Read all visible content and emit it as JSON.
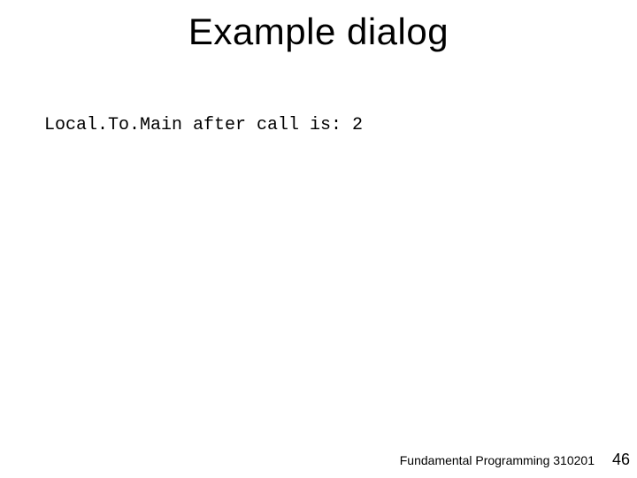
{
  "slide": {
    "title": "Example dialog",
    "body_line": "Local.To.Main after call is: 2",
    "footer": "Fundamental Programming 310201",
    "page_number": "46"
  }
}
